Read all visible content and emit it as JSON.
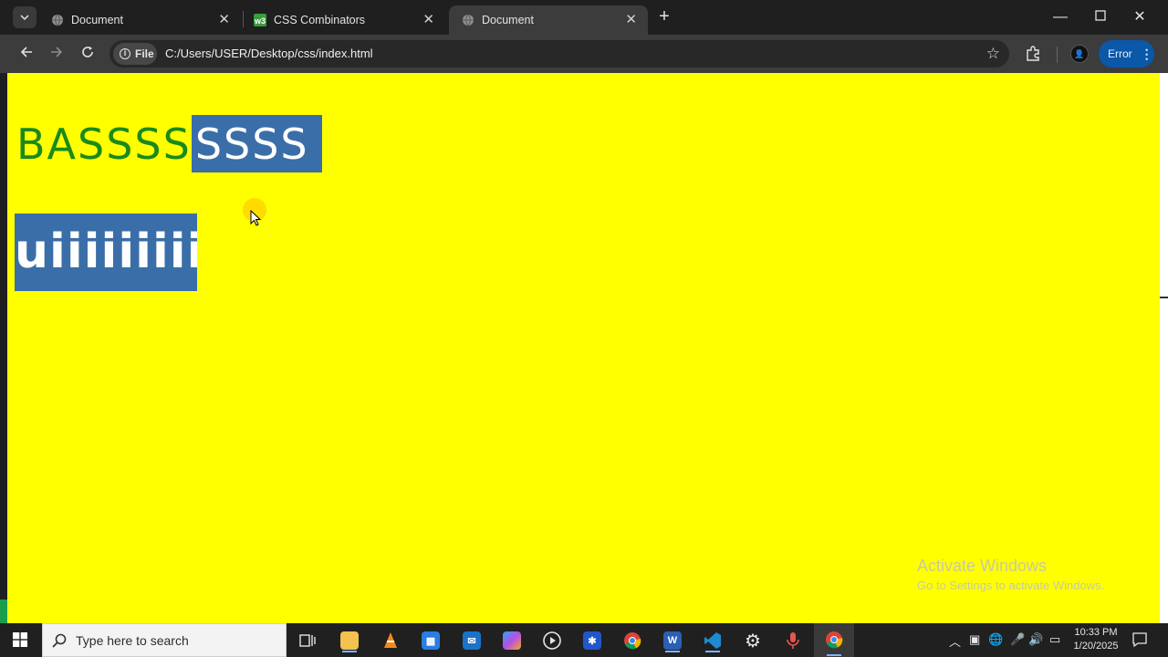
{
  "browser": {
    "tabs": [
      {
        "title": "Document",
        "active": false
      },
      {
        "title": "CSS Combinators",
        "active": false
      },
      {
        "title": "Document",
        "active": true
      }
    ],
    "address": {
      "chip_label": "File",
      "url": "C:/Users/USER/Desktop/css/index.html"
    },
    "error_label": "Error"
  },
  "page": {
    "heading_unselected": "BASSSS",
    "heading_selected": "SSSS",
    "paragraph_text": "uiiiiiiiiii",
    "background_color": "#ffff00",
    "selection_color": "#3a6ea8"
  },
  "watermark": {
    "line1": "Activate Windows",
    "line2": "Go to Settings to activate Windows."
  },
  "taskbar": {
    "search_placeholder": "Type here to search",
    "time": "10:33 PM",
    "date": "1/20/2025"
  }
}
